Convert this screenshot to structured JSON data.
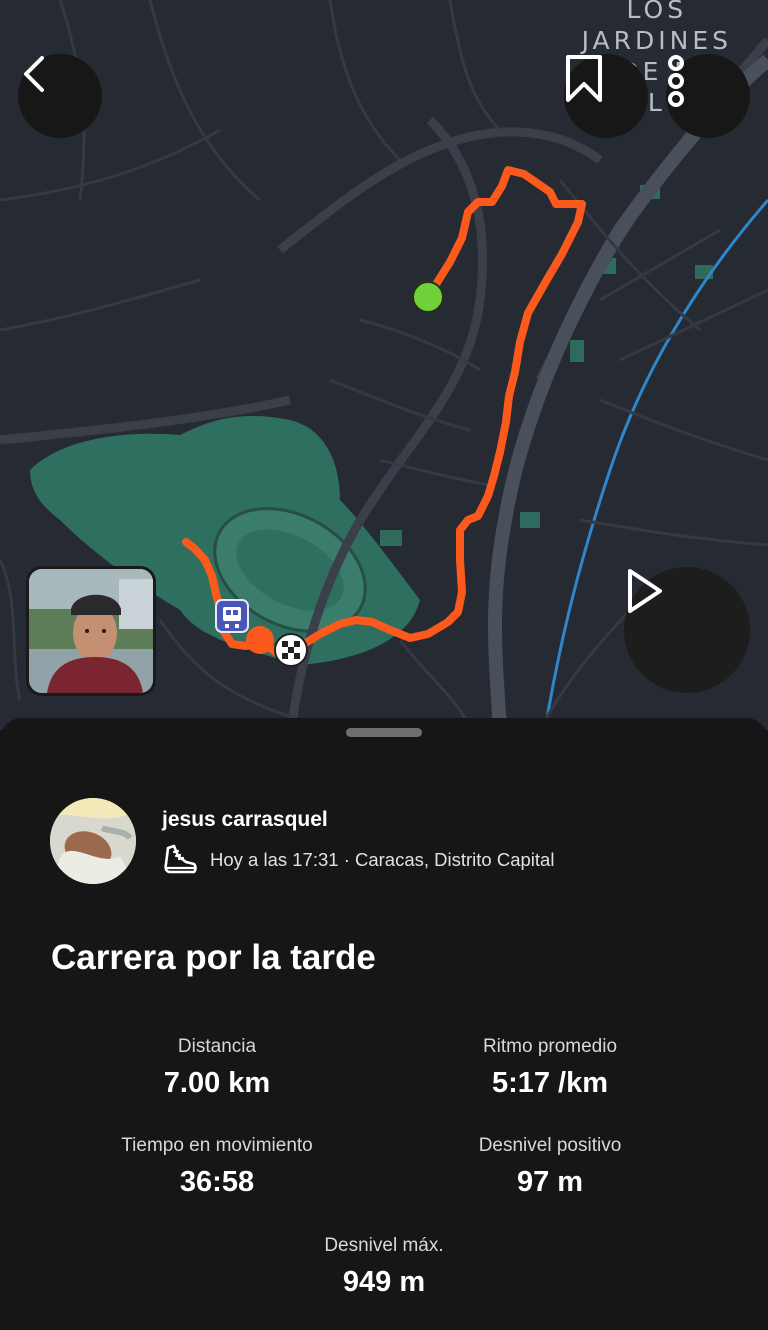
{
  "map": {
    "area_label_lines": [
      "LOS",
      "JARDINES",
      "DE E",
      "L"
    ],
    "route_color": "#fc5a1c",
    "start_color": "#6fd23a"
  },
  "header": {
    "back_icon": "chevron-left-icon",
    "bookmark_icon": "bookmark-icon",
    "more_icon": "vertical-dots-icon"
  },
  "media": {
    "play_icon": "play-icon"
  },
  "activity": {
    "athlete_name": "jesus carrasquel",
    "sport_icon": "running-shoe-icon",
    "meta": "Hoy a las 17:31 · Caracas, Distrito Capital",
    "title": "Carrera por la tarde",
    "stats": [
      {
        "label": "Distancia",
        "value": "7.00 km"
      },
      {
        "label": "Ritmo promedio",
        "value": "5:17 /km"
      },
      {
        "label": "Tiempo en movimiento",
        "value": "36:58"
      },
      {
        "label": "Desnivel positivo",
        "value": "97 m"
      },
      {
        "label": "Desnivel máx.",
        "value": "949 m"
      }
    ]
  }
}
